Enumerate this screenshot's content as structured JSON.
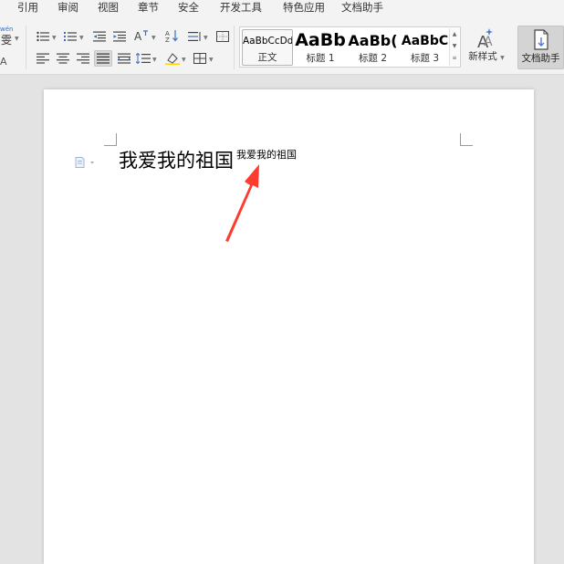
{
  "menu": {
    "items": [
      "引用",
      "审阅",
      "视图",
      "章节",
      "安全",
      "开发工具",
      "特色应用",
      "文档助手"
    ]
  },
  "ribbon": {
    "partial_left_label": "wén",
    "partial_left_glyph": "雯",
    "partial_left_glyph2": "A",
    "styles": [
      {
        "sample": "AaBbCcDd",
        "name": "正文"
      },
      {
        "sample": "AaBb",
        "name": "标题 1"
      },
      {
        "sample": "AaBb(",
        "name": "标题 2"
      },
      {
        "sample": "AaBbC",
        "name": "标题 3"
      }
    ],
    "new_style_label": "新样式",
    "doc_helper_label": "文档助手"
  },
  "document": {
    "main_text": "我爱我的祖国",
    "superscript_text": "我爱我的祖国"
  },
  "colors": {
    "arrow": "#ff3b30",
    "accent_blue": "#4a7bd0"
  }
}
